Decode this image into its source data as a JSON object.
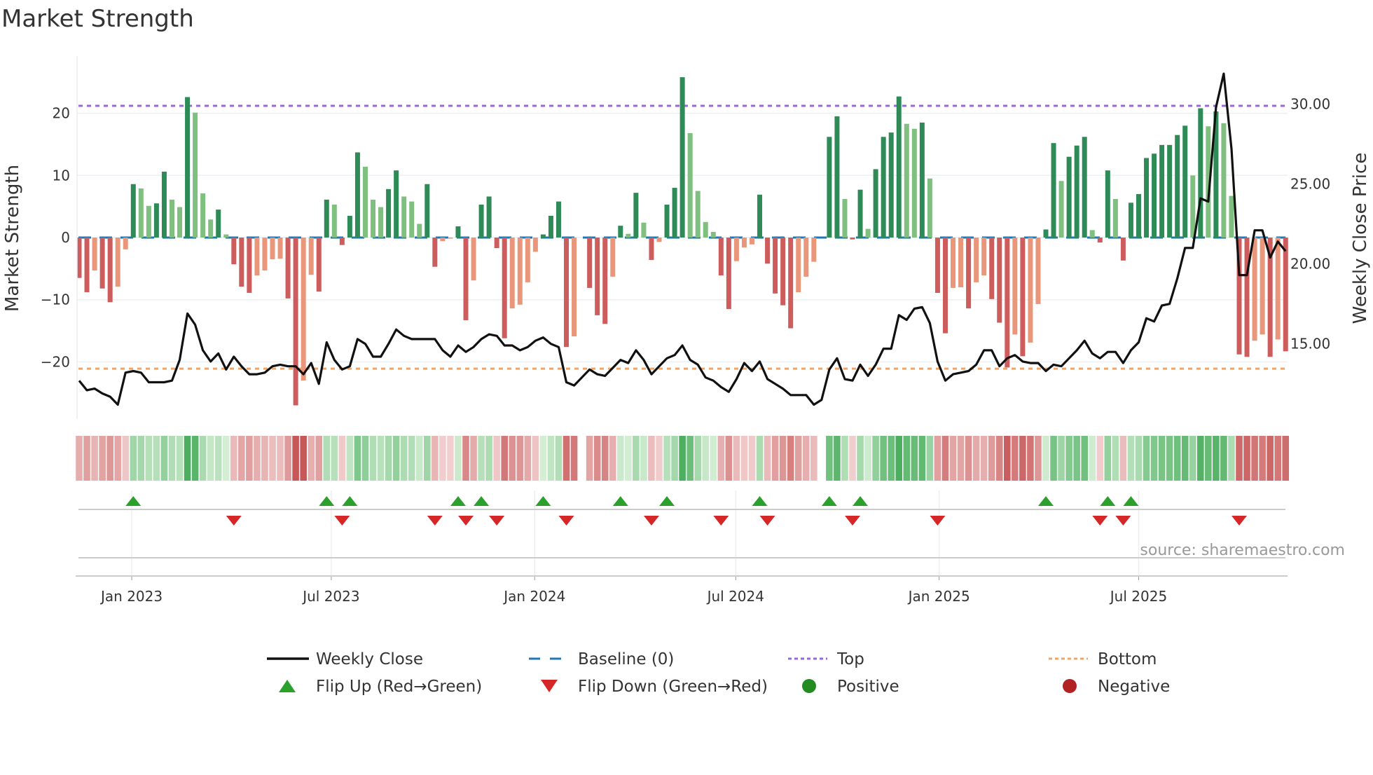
{
  "chart_data": {
    "type": "bar",
    "title": "Market Strength",
    "ylabel": "Market Strength",
    "y2label": "Weekly Close Price",
    "ylim": [
      -29.2,
      29.2
    ],
    "y2lim": [
      10.3,
      33.0
    ],
    "yticks": [
      20,
      10,
      0,
      -10,
      -20
    ],
    "ytick_labels": [
      "20",
      "10",
      "0",
      "−10",
      "−20"
    ],
    "y2ticks": [
      30,
      25,
      20,
      15
    ],
    "y2tick_labels": [
      "30.00",
      "25.00",
      "20.00",
      "15.00"
    ],
    "x_unit": "week index",
    "xticks": [
      {
        "x": 6.8,
        "label": "Jan 2023"
      },
      {
        "x": 32.6,
        "label": "Jul 2023"
      },
      {
        "x": 58.9,
        "label": "Jan 2024"
      },
      {
        "x": 84.9,
        "label": "Jul 2024"
      },
      {
        "x": 111.2,
        "label": "Jan 2025"
      },
      {
        "x": 137.0,
        "label": "Jul 2025"
      }
    ],
    "top_level": 21.2,
    "bottom_level": -21.1,
    "baseline": 0,
    "strength": [
      -6.5,
      -8.8,
      -5.3,
      -8.2,
      -10.4,
      -7.9,
      -1.9,
      8.6,
      7.9,
      5.1,
      5.5,
      10.6,
      6.1,
      4.9,
      22.6,
      20.1,
      7.1,
      2.9,
      4.5,
      0.5,
      -4.3,
      -7.9,
      -8.9,
      -6.1,
      -5.3,
      -3.5,
      -3.4,
      -9.8,
      -27,
      -23,
      -6.0,
      -8.7,
      6.1,
      5.3,
      -1.2,
      3.5,
      13.7,
      11.4,
      6.1,
      4.9,
      7.8,
      10.8,
      6.6,
      5.8,
      2.2,
      8.6,
      -4.7,
      -0.6,
      -0.1,
      1.8,
      -13.3,
      -6.9,
      5.3,
      6.6,
      -1.7,
      -16.2,
      -11.4,
      -10.8,
      -7.2,
      -2.3,
      0.5,
      3.5,
      5.8,
      -17.6,
      -15.9,
      0,
      -8.1,
      -12.5,
      -13.9,
      -6.3,
      1.9,
      0.6,
      7.2,
      2.4,
      -3.6,
      -0.7,
      5.3,
      8.0,
      25.8,
      16.8,
      7.5,
      2.5,
      0.9,
      -6.1,
      -11.5,
      -3.8,
      -1.6,
      -1.1,
      6.9,
      -4.2,
      -9.0,
      -10.9,
      -14.6,
      -8.8,
      -6.3,
      -3.9,
      0,
      16.2,
      19.5,
      6.2,
      -0.3,
      7.7,
      1.4,
      11.0,
      16.2,
      16.9,
      22.7,
      18.3,
      17.5,
      18.5,
      9.5,
      -8.9,
      -15.4,
      -8.1,
      -8.0,
      -11.4,
      -7.2,
      -6.1,
      -9.9,
      -13.7,
      -20.9,
      -15.6,
      -19.1,
      -16.9,
      -10.7,
      1.3,
      15.2,
      9.1,
      13.0,
      14.8,
      16.2,
      1.2,
      -0.8,
      10.8,
      6.2,
      -3.7,
      5.6,
      7.0,
      12.8,
      13.5,
      14.9,
      14.9,
      16.5,
      18.0,
      10.0,
      20.8,
      17.9,
      20.3,
      18.4,
      6.7,
      -18.8,
      -19.2,
      -16.6,
      -15.6,
      -19.2,
      -16.4,
      -18.3
    ],
    "price": [
      12.7,
      12.1,
      12.2,
      11.9,
      11.7,
      11.2,
      13.2,
      13.3,
      13.2,
      12.6,
      12.6,
      12.6,
      12.7,
      14.0,
      16.9,
      16.2,
      14.6,
      13.9,
      14.4,
      13.4,
      14.2,
      13.6,
      13.1,
      13.1,
      13.2,
      13.6,
      13.7,
      13.6,
      13.6,
      13.1,
      13.8,
      12.5,
      15.1,
      14.0,
      13.4,
      13.6,
      15.3,
      15.0,
      14.2,
      14.2,
      15.0,
      15.9,
      15.5,
      15.3,
      15.3,
      15.3,
      15.3,
      14.6,
      14.2,
      14.9,
      14.5,
      14.8,
      15.3,
      15.6,
      15.5,
      14.9,
      14.9,
      14.6,
      14.8,
      15.2,
      15.4,
      15.0,
      14.8,
      12.6,
      12.4,
      12.9,
      13.4,
      13.1,
      13.0,
      13.5,
      14.0,
      13.8,
      14.6,
      14.0,
      13.1,
      13.6,
      14.1,
      14.3,
      14.9,
      14.0,
      13.7,
      12.9,
      12.7,
      12.3,
      12.0,
      12.8,
      13.8,
      13.3,
      13.9,
      12.8,
      12.5,
      12.2,
      11.8,
      11.8,
      11.8,
      11.2,
      11.5,
      13.4,
      14.1,
      12.8,
      12.7,
      13.7,
      13.0,
      13.7,
      14.7,
      14.7,
      16.8,
      16.5,
      17.2,
      17.3,
      16.3,
      13.9,
      12.7,
      13.1,
      13.2,
      13.3,
      13.7,
      14.6,
      14.6,
      13.6,
      14.1,
      14.3,
      13.9,
      13.8,
      13.8,
      13.3,
      13.7,
      13.6,
      14.1,
      14.6,
      15.2,
      14.4,
      14.1,
      14.5,
      14.5,
      13.8,
      14.6,
      15.1,
      16.6,
      16.4,
      17.4,
      17.5,
      19.1,
      21.0,
      21.0,
      24.1,
      23.9,
      29.8,
      31.9,
      27.2,
      19.3,
      19.3,
      22.1,
      22.1,
      20.4,
      21.4,
      20.8
    ],
    "colors": {
      "strong_green": "#2e8b57",
      "light_green": "#7fbf7f",
      "strong_red": "#cd5c5c",
      "light_red": "#e9967a",
      "line": "#111111",
      "baseline": "#1f77b4",
      "top": "#9966dd",
      "bottom": "#f4a460",
      "flip_up": "#2ca02c",
      "flip_down": "#d62728",
      "positive": "#228b22",
      "negative": "#b22222"
    },
    "legend": [
      {
        "label": "Weekly Close",
        "kind": "line"
      },
      {
        "label": "Baseline (0)",
        "kind": "dash"
      },
      {
        "label": "Top",
        "kind": "dot-purple"
      },
      {
        "label": "Bottom",
        "kind": "dot-orange"
      },
      {
        "label": "Flip Up (Red→Green)",
        "kind": "tri-up"
      },
      {
        "label": "Flip Down (Green→Red)",
        "kind": "tri-down"
      },
      {
        "label": "Positive",
        "kind": "dot-green"
      },
      {
        "label": "Negative",
        "kind": "dot-red"
      }
    ],
    "legend_placement": "bottom",
    "source": "source: sharemaestro.com"
  }
}
